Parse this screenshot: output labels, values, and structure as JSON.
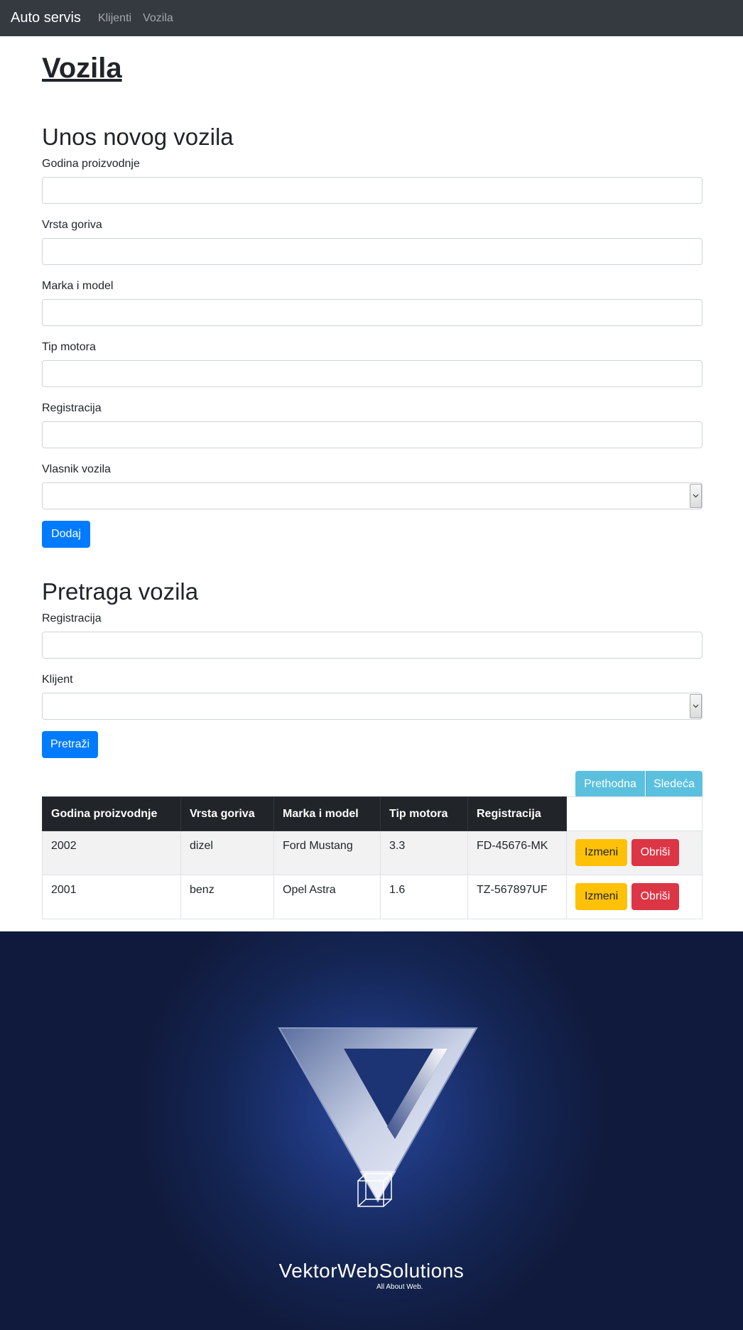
{
  "navbar": {
    "brand": "Auto servis",
    "links": [
      "Klijenti",
      "Vozila"
    ]
  },
  "page": {
    "title": "Vozila"
  },
  "add_form": {
    "title": "Unos novog vozila",
    "labels": {
      "year": "Godina proizvodnje",
      "fuel": "Vrsta goriva",
      "make_model": "Marka i model",
      "engine": "Tip motora",
      "registration": "Registracija",
      "owner": "Vlasnik vozila"
    },
    "values": {
      "year": "",
      "fuel": "",
      "make_model": "",
      "engine": "",
      "registration": "",
      "owner": ""
    },
    "submit_label": "Dodaj"
  },
  "search_form": {
    "title": "Pretraga vozila",
    "labels": {
      "registration": "Registracija",
      "client": "Klijent"
    },
    "submit_label": "Pretraži"
  },
  "pagination": {
    "prev_label": "Prethodna",
    "next_label": "Sledeća"
  },
  "table": {
    "headers": [
      "Godina proizvodnje",
      "Vrsta goriva",
      "Marka i model",
      "Tip motora",
      "Registracija"
    ],
    "rows": [
      {
        "year": "2002",
        "fuel": "dizel",
        "make_model": "Ford Mustang",
        "engine": "3.3",
        "registration": "FD-45676-MK"
      },
      {
        "year": "2001",
        "fuel": "benz",
        "make_model": "Opel Astra",
        "engine": "1.6",
        "registration": "TZ-567897UF"
      }
    ],
    "edit_label": "Izmeni",
    "delete_label": "Obriši"
  },
  "banner": {
    "company": "VektorWebSolutions",
    "tagline": "All About Web."
  },
  "colors": {
    "navbar": "#343a40",
    "primary": "#007bff",
    "info": "#5bc0de",
    "warning": "#ffc107",
    "danger": "#dc3545",
    "banner_bg": "#101a3c"
  },
  "icons": {
    "select_arrow": "chevron-down-icon",
    "logo": "v-logo-icon",
    "cube": "cube-icon"
  }
}
